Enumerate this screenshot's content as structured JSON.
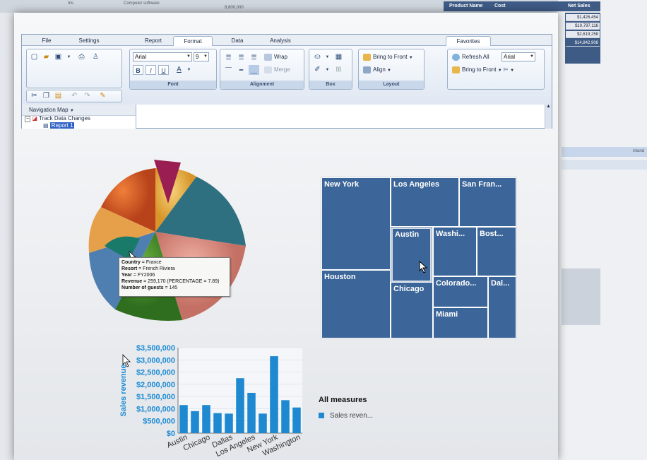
{
  "background_window": {
    "top_items": [
      "Iris",
      "Computer software",
      "8,800,000"
    ],
    "table_headers": [
      "Product Name",
      "Cost",
      "Net Sales"
    ],
    "values": [
      "$1,426,454",
      "$10,797,116",
      "$2,619,258",
      "$14,842,908"
    ],
    "band_label": "inland"
  },
  "ribbon": {
    "tabs": [
      "File",
      "Settings",
      "Report",
      "Format",
      "Data",
      "Analysis",
      "Favorites"
    ],
    "active_tab": "Format",
    "font": {
      "family": "Arial",
      "size": "9",
      "label": "Font"
    },
    "alignment": {
      "wrap": "Wrap",
      "merge": "Merge",
      "label": "Alignment"
    },
    "box": {
      "label": "Box"
    },
    "layout": {
      "bring_to_front": "Bring to Front",
      "align": "Align",
      "label": "Layout"
    },
    "favorites": {
      "refresh_all": "Refresh All",
      "font": "Arial",
      "bring_to_front": "Bring to Front"
    }
  },
  "navigation": {
    "title": "Navigation Map",
    "root": "Track Data Changes",
    "child": "Report 1"
  },
  "tooltip": {
    "country_label": "Country",
    "country": "France",
    "resort_label": "Resort",
    "resort": "French Riviera",
    "year_label": "Year",
    "year": "FY2006",
    "revenue_label": "Revenue",
    "revenue": "259,170 (PERCENTAGE = 7.89)",
    "guests_label": "Number of guests",
    "guests": "145"
  },
  "treemap": {
    "cells": [
      "New York",
      "Los Angeles",
      "San Fran...",
      "Austin",
      "Washi...",
      "Bost...",
      "Houston",
      "Chicago",
      "Colorado...",
      "Dal...",
      "Miami"
    ],
    "selected": "Austin",
    "color": "#3c6699"
  },
  "chart_data": {
    "type": "bar",
    "ylabel": "Sales revenue",
    "ylim": [
      0,
      3500000
    ],
    "yticks": [
      "$0",
      "$500,000",
      "$1,000,000",
      "$1,500,000",
      "$2,000,000",
      "$2,500,000",
      "$3,000,000",
      "$3,500,000"
    ],
    "x_tick_labels": [
      "Austin",
      "Chicago",
      "Dallas",
      "Los Angeles",
      "New York",
      "Washington"
    ],
    "values": [
      1150000,
      900000,
      1150000,
      820000,
      800000,
      2250000,
      1650000,
      800000,
      3150000,
      1350000,
      1050000
    ],
    "color": "#1e88d0",
    "legend_title": "All measures",
    "legend_items": [
      "Sales reven..."
    ]
  }
}
